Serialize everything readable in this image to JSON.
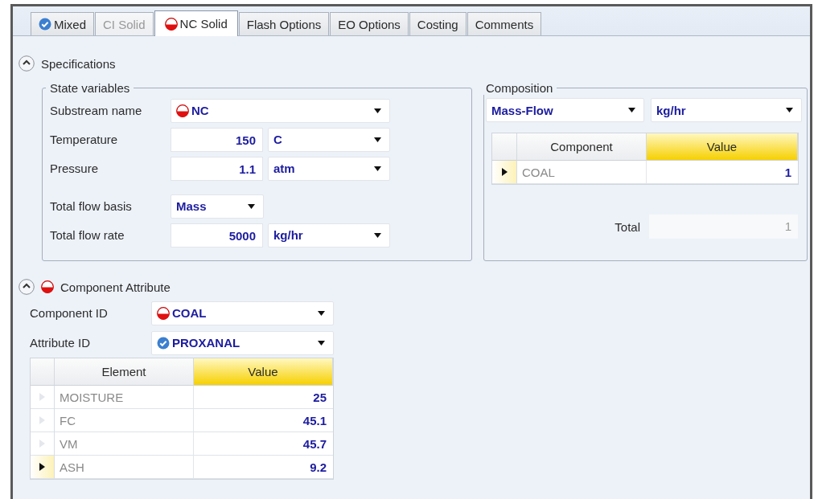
{
  "tabs": [
    {
      "label": "Mixed",
      "complete": true,
      "disabled": false,
      "selected": false
    },
    {
      "label": "CI Solid",
      "disabled": true,
      "selected": false
    },
    {
      "label": "NC Solid",
      "complete": false,
      "disabled": false,
      "selected": true
    },
    {
      "label": "Flash Options",
      "disabled": false,
      "selected": false
    },
    {
      "label": "EO Options",
      "disabled": false,
      "selected": false
    },
    {
      "label": "Costing",
      "disabled": false,
      "selected": false
    },
    {
      "label": "Comments",
      "disabled": false,
      "selected": false
    }
  ],
  "specifications": {
    "title": "Specifications",
    "expanded": true,
    "state_variables": {
      "title": "State variables",
      "rows": [
        {
          "kind": "combo",
          "label": "Substream name",
          "value": "NC",
          "complete": false
        },
        {
          "kind": "value_unit",
          "label": "Temperature",
          "value": "150",
          "unit": "C"
        },
        {
          "kind": "value_unit",
          "label": "Pressure",
          "value": "1.1",
          "unit": "atm"
        },
        {
          "kind": "short_combo",
          "label": "Total flow basis",
          "value": "Mass"
        },
        {
          "kind": "value_unit",
          "label": "Total flow rate",
          "value": "5000",
          "unit": "kg/hr"
        }
      ]
    },
    "composition": {
      "title": "Composition",
      "basis": "Mass-Flow",
      "unit": "kg/hr",
      "columns": [
        {
          "label": "Component",
          "highlighted": false
        },
        {
          "label": "Value",
          "highlighted": true
        }
      ],
      "rows": [
        {
          "component": "COAL",
          "value": "1",
          "current": true
        }
      ],
      "total_label": "Total",
      "total": "1"
    }
  },
  "component_attribute": {
    "title": "Component Attribute",
    "complete": false,
    "expanded": true,
    "fields": [
      {
        "label": "Component ID",
        "value": "COAL",
        "complete": false
      },
      {
        "label": "Attribute ID",
        "value": "PROXANAL",
        "complete": true
      }
    ],
    "columns": [
      {
        "label": "Element",
        "highlighted": false
      },
      {
        "label": "Value",
        "highlighted": true
      }
    ],
    "rows": [
      {
        "element": "MOISTURE",
        "value": "25",
        "current": false
      },
      {
        "element": "FC",
        "value": "45.1",
        "current": false
      },
      {
        "element": "VM",
        "value": "45.7",
        "current": false
      },
      {
        "element": "ASH",
        "value": "9.2",
        "current": true
      }
    ]
  }
}
